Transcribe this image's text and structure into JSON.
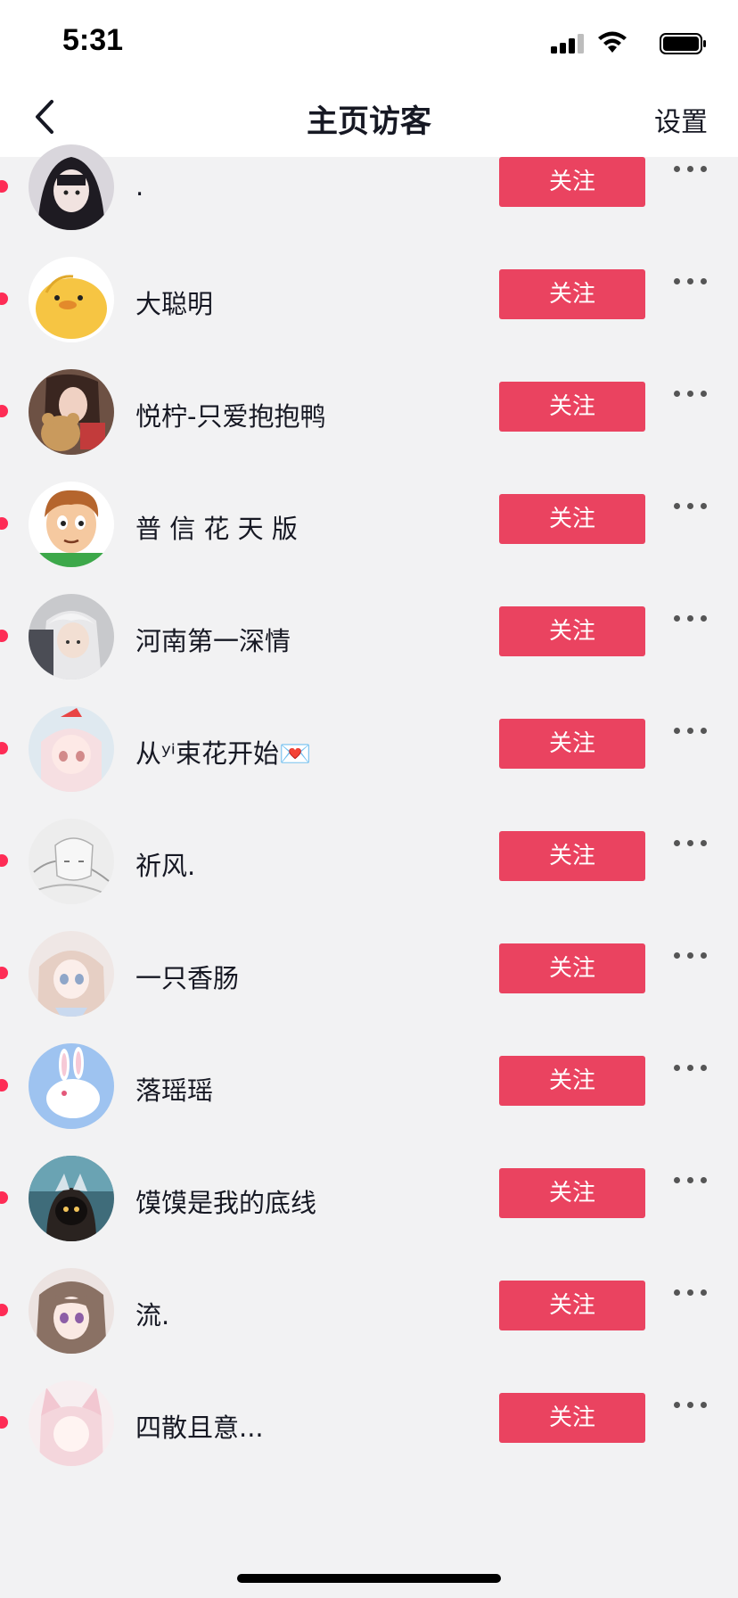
{
  "status_bar": {
    "time": "5:31",
    "icons": [
      "signal-icon",
      "wifi-icon",
      "battery-icon"
    ]
  },
  "nav": {
    "back_icon": "chevron-left-icon",
    "title": "主页访客",
    "settings_label": "设置"
  },
  "colors": {
    "accent": "#ea4360",
    "unread_dot": "#fe2c55",
    "background": "#f2f2f3"
  },
  "follow_label": "关注",
  "more_icon": "more-horizontal-icon",
  "visitors": [
    {
      "name": ".",
      "avatar": "avatar-gothic-girl",
      "unread": true
    },
    {
      "name": "大聪明",
      "avatar": "avatar-yellow-chick",
      "unread": true
    },
    {
      "name": "悦柠-只爱抱抱鸭",
      "avatar": "avatar-girl-with-teddy-bear",
      "unread": true
    },
    {
      "name": "普 信 花 天 版",
      "avatar": "avatar-cartoon-boy",
      "unread": true
    },
    {
      "name": "河南第一深情",
      "avatar": "avatar-anime-boy",
      "unread": true
    },
    {
      "name": "从ʸⁱ束花开始💌",
      "avatar": "avatar-anime-girl-pink",
      "unread": true
    },
    {
      "name": "祈风.",
      "avatar": "avatar-sketch-anime",
      "unread": true
    },
    {
      "name": "一只香肠",
      "avatar": "avatar-anime-girl-light",
      "unread": true
    },
    {
      "name": "落瑶瑶",
      "avatar": "avatar-white-rabbit",
      "unread": true
    },
    {
      "name": "馍馍是我的底线",
      "avatar": "avatar-hooded-figure",
      "unread": true
    },
    {
      "name": "流.",
      "avatar": "avatar-anime-girl-brown",
      "unread": true
    },
    {
      "name": "四散且意...",
      "avatar": "avatar-anime-catgirl",
      "unread": true
    }
  ]
}
